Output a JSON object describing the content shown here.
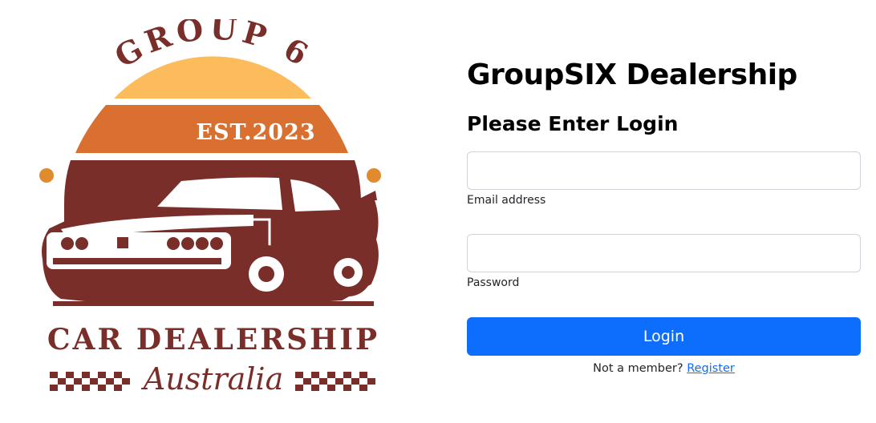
{
  "logo": {
    "top_text": "GROUP 6",
    "est_text": "EST.2023",
    "main_text": "CAR DEALERSHIP",
    "script_text": "Australia",
    "colors": {
      "sun_yellow": "#fdbc5b",
      "sun_orange": "#d9702f",
      "maroon": "#7a2e2a",
      "dot": "#e08c2e"
    }
  },
  "header": {
    "title": "GroupSIX Dealership",
    "subtitle": "Please Enter Login"
  },
  "form": {
    "email": {
      "value": "",
      "placeholder": "",
      "label": "Email address"
    },
    "password": {
      "value": "",
      "placeholder": "",
      "label": "Password"
    },
    "submit_label": "Login",
    "register_prompt": "Not a member?",
    "register_link": "Register"
  },
  "colors": {
    "primary": "#0d6efd",
    "input_border": "#ced4da"
  }
}
